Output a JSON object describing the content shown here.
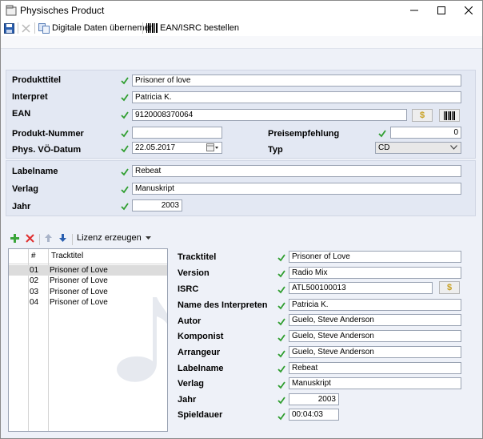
{
  "window": {
    "title": "Physisches Product"
  },
  "toolbar": {
    "digitale_label": "Digitale Daten übernemen",
    "ean_label": "EAN/ISRC bestellen"
  },
  "product": {
    "produkttitel": {
      "label": "Produkttitel",
      "value": "Prisoner of love"
    },
    "interpret": {
      "label": "Interpret",
      "value": "Patricia K."
    },
    "ean": {
      "label": "EAN",
      "value": "9120008370064"
    },
    "produkt_nummer": {
      "label": "Produkt-Nummer",
      "value": ""
    },
    "preisempfehlung": {
      "label": "Preisempfehlung",
      "value": "0"
    },
    "vo_datum": {
      "label": "Phys. VÖ-Datum",
      "value": "22.05.2017"
    },
    "typ": {
      "label": "Typ",
      "value": "CD"
    }
  },
  "label_section": {
    "labelname": {
      "label": "Labelname",
      "value": "Rebeat"
    },
    "verlag": {
      "label": "Verlag",
      "value": "Manuskript"
    },
    "jahr": {
      "label": "Jahr",
      "value": "2003"
    }
  },
  "track_toolbar": {
    "lizenz_label": "Lizenz erzeugen"
  },
  "tracklist": {
    "headers": {
      "num": "#",
      "title": "Tracktitel"
    },
    "rows": [
      {
        "num": "01",
        "title": "Prisoner of Love"
      },
      {
        "num": "02",
        "title": "Prisoner of Love"
      },
      {
        "num": "03",
        "title": "Prisoner of Love"
      },
      {
        "num": "04",
        "title": "Prisoner of Love"
      }
    ]
  },
  "track": {
    "tracktitel": {
      "label": "Tracktitel",
      "value": "Prisoner of Love"
    },
    "version": {
      "label": "Version",
      "value": "Radio Mix"
    },
    "isrc": {
      "label": "ISRC",
      "value": "ATL500100013"
    },
    "name_interpreten": {
      "label": "Name des Interpreten",
      "value": "Patricia K."
    },
    "autor": {
      "label": "Autor",
      "value": "Guelo, Steve Anderson"
    },
    "komponist": {
      "label": "Komponist",
      "value": "Guelo, Steve Anderson"
    },
    "arrangeur": {
      "label": "Arrangeur",
      "value": "Guelo, Steve Anderson"
    },
    "labelname": {
      "label": "Labelname",
      "value": "Rebeat"
    },
    "verlag": {
      "label": "Verlag",
      "value": "Manuskript"
    },
    "jahr": {
      "label": "Jahr",
      "value": "2003"
    },
    "spieldauer": {
      "label": "Spieldauer",
      "value": "00:04:03"
    }
  },
  "icons": {
    "dollar": "$",
    "check_color": "#2f9e2f",
    "delete_color": "#e03030",
    "add_color": "#3aa53a"
  }
}
